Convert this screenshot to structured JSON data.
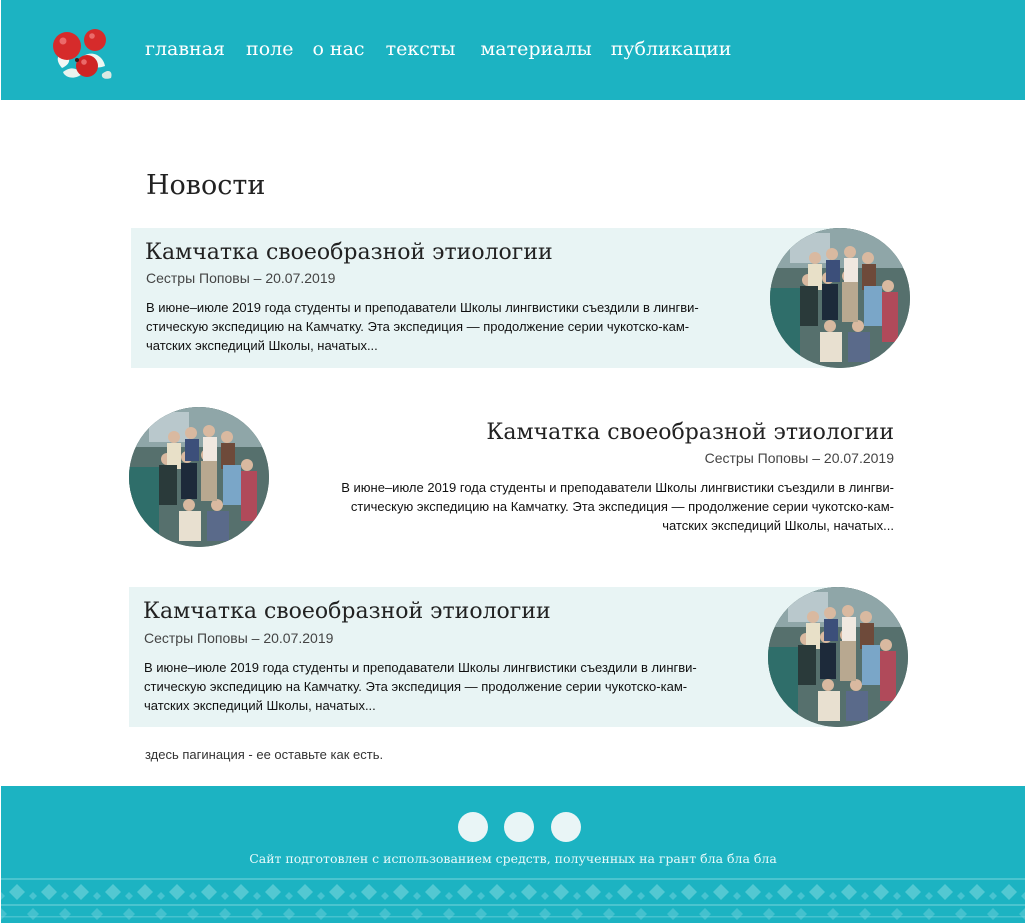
{
  "nav": {
    "items": [
      "главная",
      "поле",
      "о нас",
      "тексты",
      "материалы",
      "публикации"
    ]
  },
  "page": {
    "title": "Новости"
  },
  "news": [
    {
      "title": "Камчатка своеобразной этиологии",
      "meta": "Сестры Поповы – 20.07.2019",
      "lines": [
        "В июне–июле 2019 года студенты и преподаватели Школы лингвистики съездили в лингви-",
        "стическую экспедицию на Камчатку. Эта экспедиция — продолжение серии чукотско-кам-",
        "чатских экспедиций Школы, начатых..."
      ]
    },
    {
      "title": "Камчатка своеобразной этиологии",
      "meta": "Сестры Поповы – 20.07.2019",
      "lines": [
        "В июне–июле 2019 года студенты и преподаватели Школы лингвистики съездили в лингви-",
        "стическую экспедицию на Камчатку. Эта экспедиция — продолжение серии чукотско-кам-",
        "чатских экспедиций Школы, начатых..."
      ]
    },
    {
      "title": "Камчатка своеобразной этиологии",
      "meta": "Сестры Поповы – 20.07.2019",
      "lines": [
        "В июне–июле 2019 года студенты и преподаватели Школы лингвистики съездили в лингви-",
        "стическую экспедицию на Камчатку. Эта экспедиция — продолжение серии чукотско-кам-",
        "чатских экспедиций Школы, начатых..."
      ]
    }
  ],
  "pagination": {
    "note": "здесь пагинация - ее оставьте как есть."
  },
  "footer": {
    "text": "Сайт подготовлен с использованием средств, полученных на грант бла бла бла",
    "social_icons": [
      "social-icon-1",
      "social-icon-2",
      "social-icon-3"
    ]
  },
  "colors": {
    "brand": "#1cb3c2",
    "card_bg": "#e8f4f4",
    "berry": "#d62b2b"
  },
  "icons": {
    "logo": "berries-logo-icon"
  }
}
